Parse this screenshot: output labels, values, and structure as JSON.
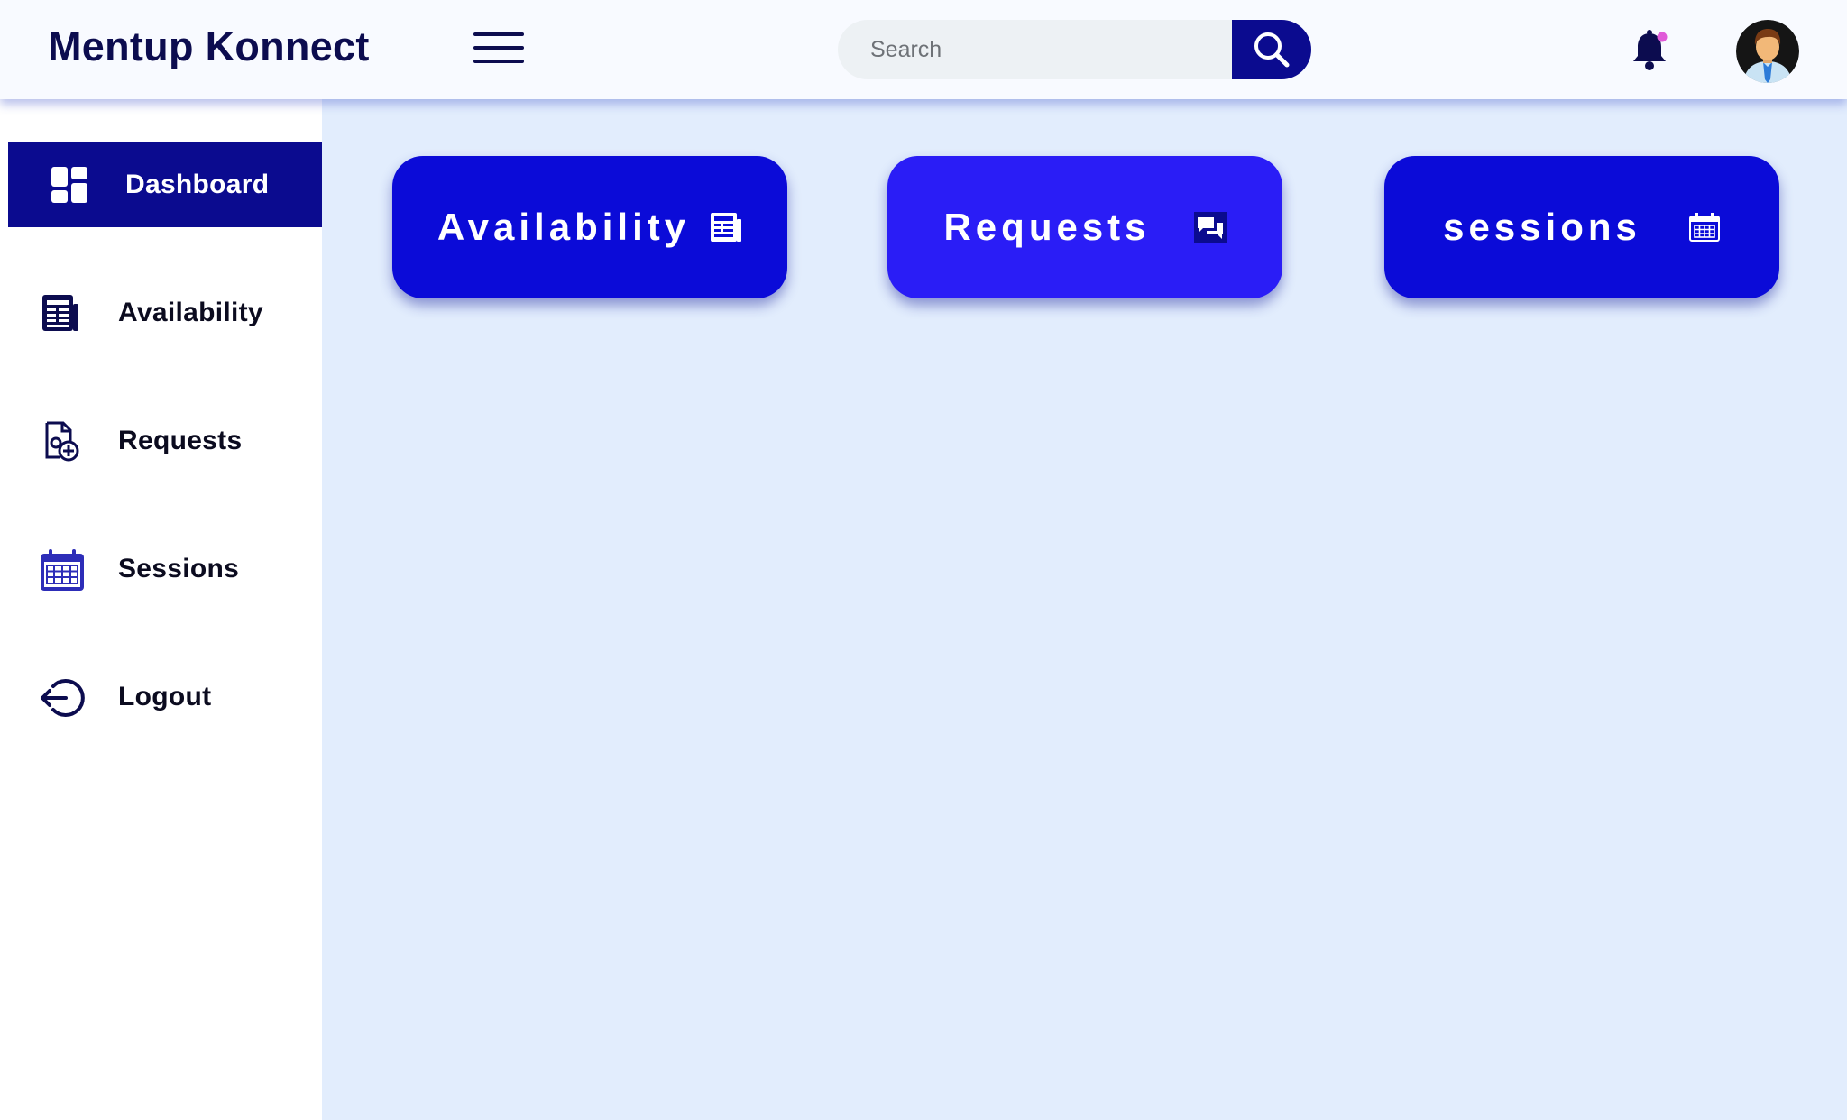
{
  "app": {
    "title": "Mentup Konnect"
  },
  "header": {
    "menu_icon": "hamburger-menu-icon",
    "search": {
      "placeholder": "Search",
      "value": "",
      "button_icon": "search-icon"
    },
    "notification_icon": "bell-icon",
    "notification_dot_color": "#e05ad8",
    "avatar_icon": "user-avatar"
  },
  "sidebar": {
    "items": [
      {
        "label": "Dashboard",
        "icon": "dashboard-grid-icon",
        "active": true
      },
      {
        "label": "Availability",
        "icon": "newspaper-icon",
        "active": false
      },
      {
        "label": "Requests",
        "icon": "document-add-icon",
        "active": false
      },
      {
        "label": "Sessions",
        "icon": "calendar-icon",
        "active": false
      },
      {
        "label": "Logout",
        "icon": "logout-icon",
        "active": false
      }
    ]
  },
  "main": {
    "cards": [
      {
        "label": "Availability",
        "icon": "newspaper-icon"
      },
      {
        "label": "Requests",
        "icon": "chat-bubbles-icon"
      },
      {
        "label": "sessions",
        "icon": "calendar-icon"
      }
    ]
  },
  "colors": {
    "primary_dark": "#0b0b8f",
    "card_blue": "#0b0bd8",
    "card_bright": "#2a1df6",
    "text_dark": "#0c0c4f",
    "background": "#e2edfd"
  }
}
